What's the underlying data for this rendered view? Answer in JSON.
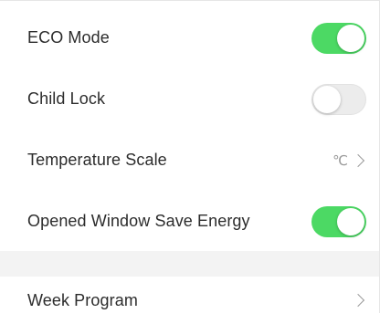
{
  "settings": {
    "eco_mode": {
      "label": "ECO Mode",
      "enabled": true
    },
    "child_lock": {
      "label": "Child Lock",
      "enabled": false
    },
    "temperature_scale": {
      "label": "Temperature Scale",
      "value": "℃"
    },
    "opened_window": {
      "label": "Opened Window Save Energy",
      "enabled": true
    },
    "week_program": {
      "label": "Week Program"
    }
  },
  "colors": {
    "toggle_on": "#4cd964",
    "toggle_off": "#ececec",
    "section_gap": "#f3f3f3"
  },
  "icons": {
    "chevron": "chevron-right-icon"
  }
}
